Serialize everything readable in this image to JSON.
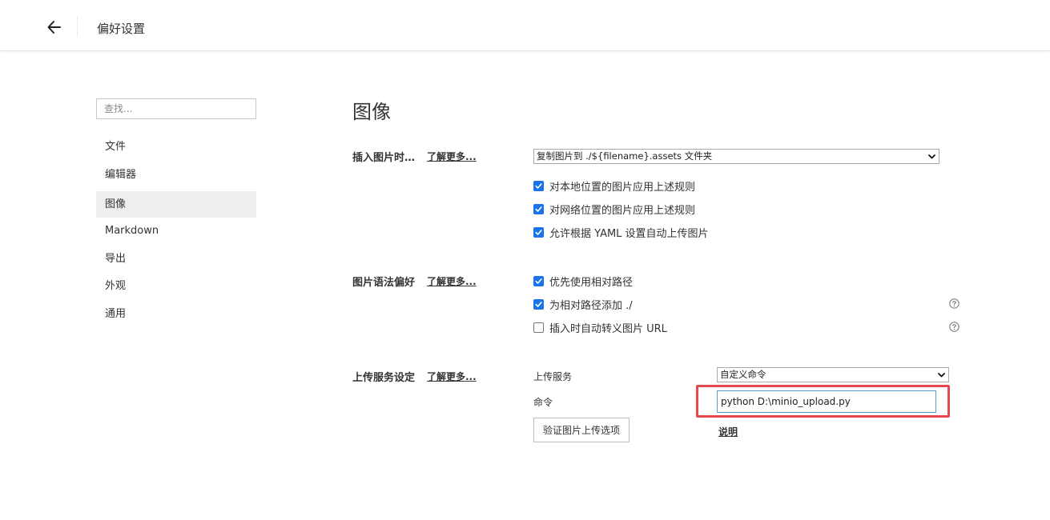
{
  "header": {
    "title": "偏好设置",
    "back_icon": "arrow-left-icon"
  },
  "sidebar": {
    "search_placeholder": "查找...",
    "items": [
      {
        "label": "文件",
        "active": false
      },
      {
        "label": "编辑器",
        "active": false
      },
      {
        "label": "图像",
        "active": true
      },
      {
        "label": "Markdown",
        "active": false
      },
      {
        "label": "导出",
        "active": false
      },
      {
        "label": "外观",
        "active": false
      },
      {
        "label": "通用",
        "active": false
      }
    ]
  },
  "main": {
    "title": "图像",
    "insert_section": {
      "label": "插入图片时…",
      "learn_more": "了解更多...",
      "select_value": "复制图片到 ./${filename}.assets 文件夹",
      "options": [
        {
          "label": "对本地位置的图片应用上述规则",
          "checked": true
        },
        {
          "label": "对网络位置的图片应用上述规则",
          "checked": true
        },
        {
          "label": "允许根据 YAML 设置自动上传图片",
          "checked": true
        }
      ]
    },
    "syntax_section": {
      "label": "图片语法偏好",
      "learn_more": "了解更多...",
      "options": [
        {
          "label": "优先使用相对路径",
          "checked": true,
          "help": false
        },
        {
          "label": "为相对路径添加 ./",
          "checked": true,
          "help": true
        },
        {
          "label": "插入时自动转义图片 URL",
          "checked": false,
          "help": true
        }
      ]
    },
    "upload_section": {
      "label": "上传服务设定",
      "learn_more": "了解更多...",
      "service_label": "上传服务",
      "service_value": "自定义命令",
      "command_label": "命令",
      "command_value": "python D:\\minio_upload.py",
      "verify_button": "验证图片上传选项",
      "doc_link": "说明"
    }
  },
  "colors": {
    "checkbox_accent": "#1a73e8",
    "highlight_border": "#e5484d",
    "active_nav_bg": "#eeeeee"
  }
}
